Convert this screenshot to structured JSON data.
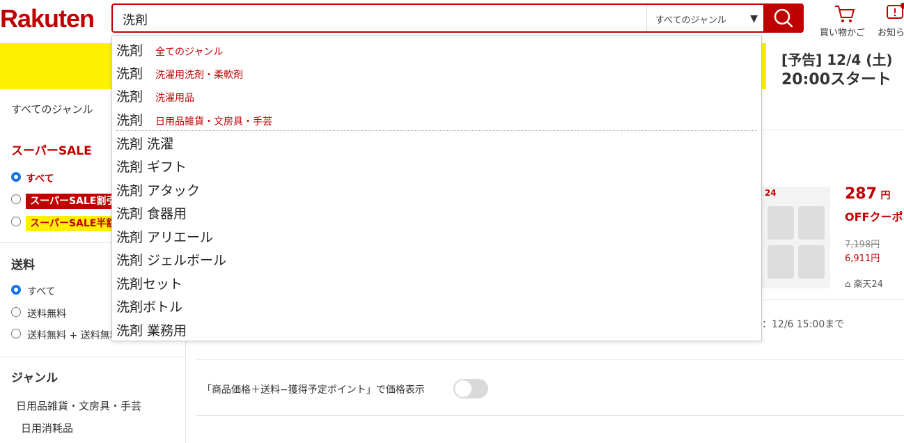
{
  "header": {
    "logo": "Rakuten",
    "search_value": "洗剤",
    "genre_select": "すべてのジャンル",
    "cart_label": "買い物かご",
    "notify_label": "お知ら"
  },
  "banner": {
    "date_line1": "[予告] 12/4 (土)",
    "date_line2": "20:00スタート"
  },
  "genre_row_label": "すべてのジャンル",
  "sidebar": {
    "super_sale_title": "スーパーSALE",
    "super_sale_options": [
      "すべて",
      "スーパーSALE割引",
      "スーパーSALE半額"
    ],
    "shipping_title": "送料",
    "shipping_options": [
      "すべて",
      "送料無料",
      "送料無料 + 送料無料"
    ],
    "genre_title": "ジャンル",
    "genre_items": [
      "日用品雑貨・文房具・手芸",
      "日用消耗品"
    ]
  },
  "product": {
    "shop_badge": "24",
    "discount": "287",
    "discount_unit": "円",
    "coupon_text": "OFFクーポ",
    "price_original": "7,198円",
    "price_sale": "6,911円",
    "shop_name": "楽天24",
    "coupon_deadline": "：12/6 15:00まで"
  },
  "price_display_label": "「商品価格＋送料−獲得予定ポイント」で価格表示",
  "suggestions": {
    "category_suggestions": [
      {
        "keyword": "洗剤",
        "category": "全てのジャンル"
      },
      {
        "keyword": "洗剤",
        "category": "洗濯用洗剤・柔軟剤"
      },
      {
        "keyword": "洗剤",
        "category": "洗濯用品"
      },
      {
        "keyword": "洗剤",
        "category": "日用品雑貨・文房具・手芸"
      }
    ],
    "keyword_suggestions": [
      "洗剤 洗濯",
      "洗剤 ギフト",
      "洗剤 アタック",
      "洗剤 食器用",
      "洗剤 アリエール",
      "洗剤 ジェルボール",
      "洗剤セット",
      "洗剤ボトル",
      "洗剤 業務用"
    ]
  },
  "colors": {
    "brand": "#bf0000",
    "banner": "#ffef00"
  }
}
